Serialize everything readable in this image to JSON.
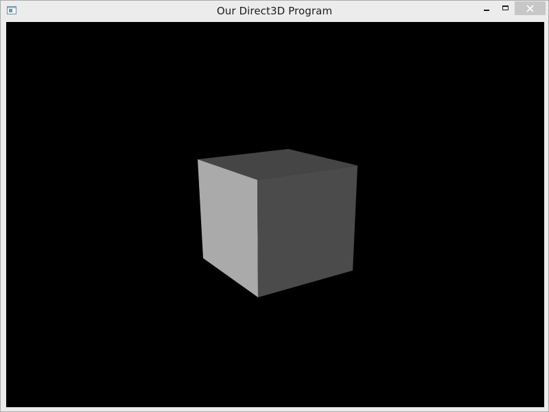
{
  "window": {
    "title": "Our Direct3D Program",
    "icons": {
      "app": "app-window-icon",
      "minimize": "minimize-icon",
      "maximize": "maximize-icon",
      "close": "close-icon"
    }
  },
  "scene": {
    "background_color": "#000000",
    "object": "cube",
    "face_colors": {
      "front": "#4b4b4b",
      "left": "#aaaaaa",
      "top": "#454545"
    }
  }
}
